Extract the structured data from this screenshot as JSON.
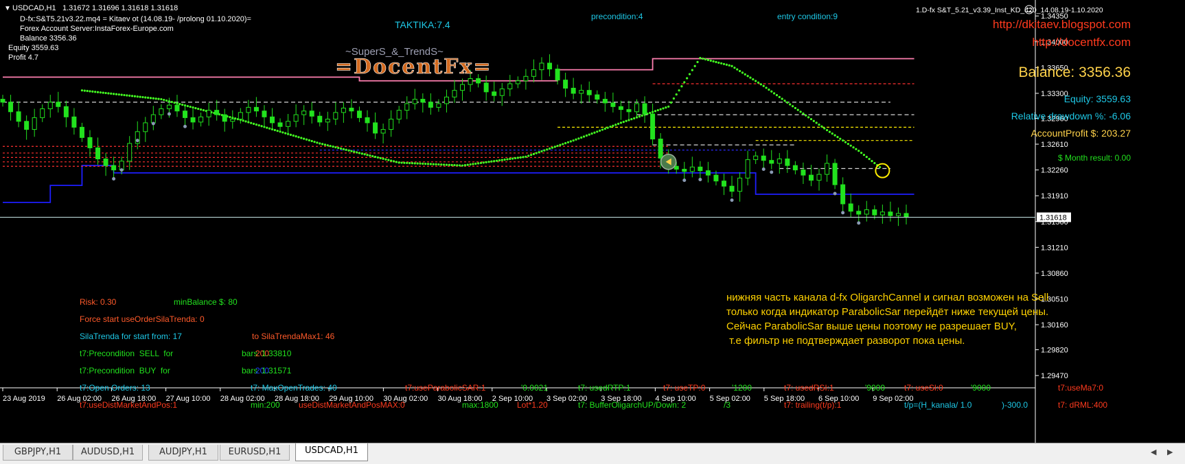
{
  "window": {
    "title": "USDCAD,H1",
    "ohlc": "1.31672 1.31696 1.31618 1.31618"
  },
  "info_lines": [
    "D-fx:S&T5.21v3.22.mq4 = Kitaev ot (14.08.19- /prolong 01.10.2020)=",
    "Forex Account Server:InstaForex-Europe.com",
    "Balance  3356.36"
  ],
  "equity_label": "Equity  3559.63",
  "profit_label": "Profit  4.7",
  "taktika": "TAKTIKA:7.4",
  "precondition": "precondition:4",
  "entry_condition": "entry condition:9",
  "expert_name": "1.D-fx S&T_5.21_v3.39_Inst_KD_420_14.08.19-1.10.2020",
  "logo": {
    "supers": "~SuperS_&_TrendS~",
    "docent": "=DocentFx="
  },
  "links": [
    "http://dkitaev.blogspot.com",
    "http://docentfx.com"
  ],
  "stats": {
    "balance": "Balance: 3356.36",
    "equity": "Equity: 3559.63",
    "drawdown": "Relative drawdown %: -6.06",
    "account_profit": "AccountProfit $: 203.27",
    "month_result": "$ Month result: 0.00"
  },
  "current_price": "1.31618",
  "comment_lines": [
    "нижняя часть канала d-fx OligarchCannel и сигнал возможен на Sell",
    "только когда индикатор ParabolicSar перейдёт ниже текущей цены.",
    "Сейчас ParabolicSar выше цены поэтому не разрешает BUY,",
    " т.е фильтр не подтверждает разворот пока цены."
  ],
  "params": [
    {
      "text": "Risk: 0.30",
      "color": "#ff5a2a"
    },
    {
      "text": "minBalance $: 80",
      "color": "#22e21e"
    },
    {
      "text": "Force start useOrderSilaTrenda: 0",
      "color": "#ff5a2a"
    },
    {
      "text": "SilaTrenda for start from: 17",
      "color": "#1ec8e6"
    },
    {
      "text": "to SilaTrendaMax1: 46",
      "color": "#ff5a2a"
    },
    {
      "text": "t7:Precondition  SELL  for",
      "color": "#22e21e"
    },
    {
      "text": "bars",
      "color": "#22e21e"
    },
    {
      "text": "200",
      "color": "#ff5a2a"
    },
    {
      "text": "1.33810",
      "color": "#22e21e"
    },
    {
      "text": "t7:Precondition  BUY  for",
      "color": "#22e21e"
    },
    {
      "text": "bars",
      "color": "#22e21e"
    },
    {
      "text": "200",
      "color": "#1e3cff"
    },
    {
      "text": "1.31571",
      "color": "#22e21e"
    },
    {
      "text": "t7:Open Orders: 13",
      "color": "#1ec8e6"
    },
    {
      "text": "t7: MaxOpenTrades: 40",
      "color": "#1ec8e6"
    },
    {
      "text": "t7:useParabolicSAR:1",
      "color": "#ff3a1e"
    },
    {
      "text": "'0.0021",
      "color": "#22e21e"
    },
    {
      "text": "t7: usedRTP:1",
      "color": "#22e21e"
    },
    {
      "text": "t7: useTP:0",
      "color": "#ff3a1e"
    },
    {
      "text": "'1200",
      "color": "#22e21e"
    },
    {
      "text": "t7: usedRSI:1",
      "color": "#ff3a1e"
    },
    {
      "text": "'9000",
      "color": "#22e21e"
    },
    {
      "text": "t7: useSl:0",
      "color": "#ff3a1e"
    },
    {
      "text": "'9000",
      "color": "#22e21e"
    },
    {
      "text": "t7:useMa7:0",
      "color": "#ff3a1e"
    },
    {
      "text": "t7:useDistMarketAndPos:1",
      "color": "#ff3a1e"
    },
    {
      "text": "min:200",
      "color": "#22e21e"
    },
    {
      "text": "useDistMarketAndPosMAX:0",
      "color": "#ff3a1e"
    },
    {
      "text": "max:1800",
      "color": "#22e21e"
    },
    {
      "text": "Lot*1.20",
      "color": "#ff3a1e"
    },
    {
      "text": "t7: BufferOligarchUP/Down: 2",
      "color": "#22e21e"
    },
    {
      "text": "/3",
      "color": "#22e21e"
    },
    {
      "text": "t7: trailing(t/p):1",
      "color": "#ff3a1e"
    },
    {
      "text": "t/p=(H_kanala/ 1.0",
      "color": "#1ec8e6"
    },
    {
      "text": ")-300.0",
      "color": "#1ec8e6"
    },
    {
      "text": "t7: dRML:400",
      "color": "#ff3a1e"
    }
  ],
  "tabs": [
    "GBPJPY,H1",
    "AUDUSD,H1",
    "AUDJPY,H1",
    "EURUSD,H1",
    "USDCAD,H1"
  ],
  "active_tab": "USDCAD,H1",
  "colors": {
    "up_candle": "#22e21e",
    "down_candle": "#22e21e",
    "sar": "#44ff22",
    "channel_upper": "#ff7fb0",
    "channel_lower": "#1e1eff",
    "background": "#000000",
    "axis_text": "#ffffff"
  },
  "chart_data": {
    "type": "candlestick",
    "symbol": "USDCAD",
    "timeframe": "H1",
    "x_ticks": [
      "23 Aug 2019",
      "26 Aug 02:00",
      "26 Aug 18:00",
      "27 Aug 10:00",
      "28 Aug 02:00",
      "28 Aug 18:00",
      "29 Aug 10:00",
      "30 Aug 02:00",
      "30 Aug 18:00",
      "2 Sep 10:00",
      "3 Sep 02:00",
      "3 Sep 18:00",
      "4 Sep 10:00",
      "5 Sep 02:00",
      "5 Sep 18:00",
      "6 Sep 10:00",
      "9 Sep 02:00"
    ],
    "y_ticks": [
      "1.34350",
      "1.34000",
      "1.33650",
      "1.33300",
      "1.32960",
      "1.32610",
      "1.32260",
      "1.31910",
      "1.31560",
      "1.31210",
      "1.30860",
      "1.30510",
      "1.30160",
      "1.29820",
      "1.29470"
    ],
    "ylim": [
      1.2935,
      1.3452
    ],
    "close_series": [
      1.3318,
      1.3305,
      1.3292,
      1.3281,
      1.3297,
      1.3309,
      1.3318,
      1.3312,
      1.3298,
      1.3284,
      1.327,
      1.3256,
      1.3241,
      1.3232,
      1.3226,
      1.3238,
      1.3262,
      1.3278,
      1.329,
      1.3301,
      1.3309,
      1.3314,
      1.3306,
      1.3297,
      1.3291,
      1.3298,
      1.3307,
      1.3301,
      1.3292,
      1.3295,
      1.3304,
      1.3311,
      1.3306,
      1.3298,
      1.329,
      1.3285,
      1.3292,
      1.3301,
      1.3306,
      1.3299,
      1.3291,
      1.3295,
      1.3304,
      1.331,
      1.3306,
      1.3297,
      1.329,
      1.3276,
      1.3281,
      1.3295,
      1.3307,
      1.3316,
      1.3322,
      1.3318,
      1.3311,
      1.3316,
      1.3325,
      1.3334,
      1.3342,
      1.335,
      1.3344,
      1.3332,
      1.3327,
      1.3336,
      1.3343,
      1.3347,
      1.3353,
      1.3362,
      1.3371,
      1.3363,
      1.3348,
      1.3337,
      1.333,
      1.3334,
      1.3328,
      1.3322,
      1.3317,
      1.3312,
      1.3308,
      1.3305,
      1.3316,
      1.3302,
      1.3268,
      1.3242,
      1.3231,
      1.3227,
      1.3224,
      1.323,
      1.3225,
      1.3219,
      1.3211,
      1.3204,
      1.3197,
      1.3215,
      1.324,
      1.3245,
      1.3239,
      1.3235,
      1.3241,
      1.3232,
      1.3226,
      1.3219,
      1.3212,
      1.322,
      1.3235,
      1.3206,
      1.318,
      1.317,
      1.3166,
      1.3172,
      1.3165,
      1.3169,
      1.3164,
      1.3167,
      1.3162
    ],
    "current_price": 1.31618,
    "channel_upper_segments": [
      [
        0,
        45,
        1.3352
      ],
      [
        45,
        70,
        1.3347
      ],
      [
        70,
        82,
        1.3362
      ],
      [
        82,
        115,
        1.3377
      ]
    ],
    "channel_lower_segments": [
      [
        0,
        6,
        1.3182
      ],
      [
        6,
        10,
        1.3205
      ],
      [
        10,
        14,
        1.3232
      ],
      [
        14,
        95,
        1.3222
      ],
      [
        95,
        115,
        1.3193
      ]
    ],
    "sar_dots": [
      [
        10,
        1.3334
      ],
      [
        20,
        1.3322
      ],
      [
        30,
        1.3294
      ],
      [
        40,
        1.3262
      ],
      [
        50,
        1.3236
      ],
      [
        58,
        1.3232
      ],
      [
        66,
        1.3244
      ],
      [
        72,
        1.3266
      ],
      [
        78,
        1.329
      ],
      [
        84,
        1.3312
      ],
      [
        88,
        1.3378
      ],
      [
        92,
        1.3367
      ],
      [
        96,
        1.334
      ],
      [
        100,
        1.331
      ],
      [
        104,
        1.328
      ],
      [
        108,
        1.3252
      ],
      [
        111,
        1.3227
      ]
    ],
    "signal_circle": {
      "index": 111,
      "price": 1.3225
    },
    "entry_marker": {
      "index": 84,
      "price": 1.3237
    },
    "legend": "none",
    "grid": false
  }
}
